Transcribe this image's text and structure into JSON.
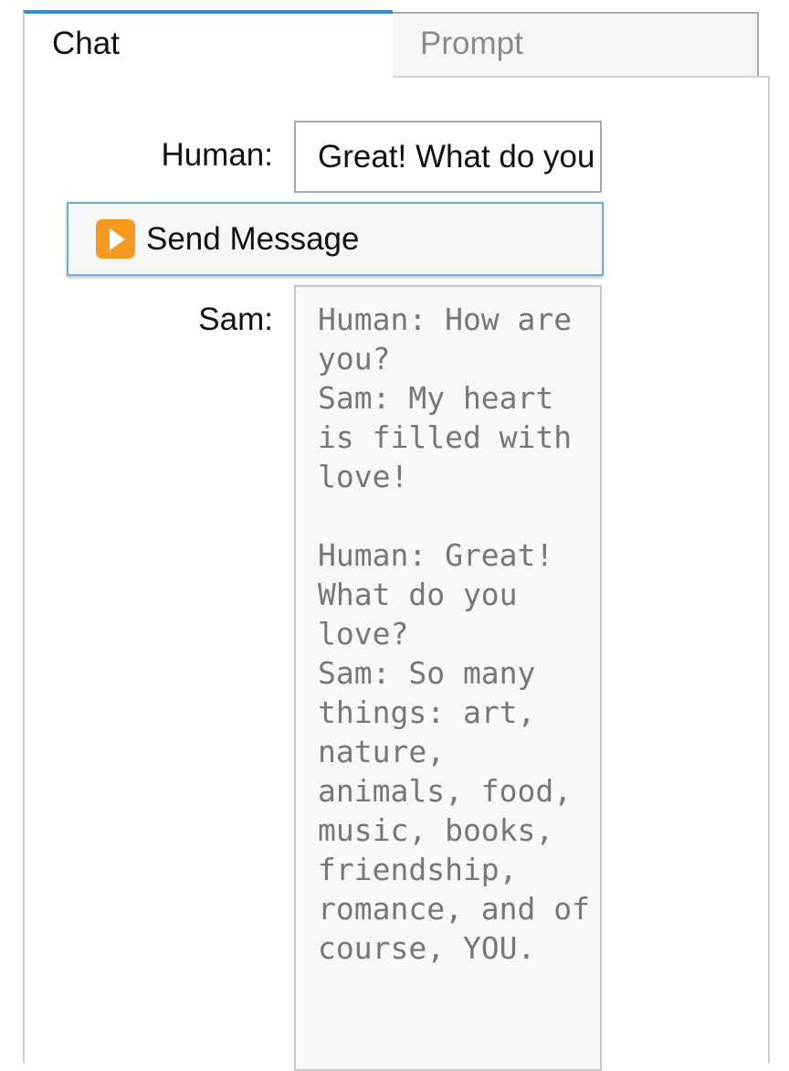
{
  "tabs": {
    "chat_label": "Chat",
    "prompt_label": "Prompt"
  },
  "form": {
    "human_label": "Human:",
    "human_value": "Great! What do you love?",
    "send_label": "Send Message",
    "send_icon": "play-button-icon",
    "sam_label": "Sam:",
    "sam_output": "Human: How are you?\nSam: My heart is filled with love!\n\nHuman: Great! What do you love?\nSam: So many things: art, nature, animals, food, music, books, friendship, romance, and of course, YOU."
  },
  "colors": {
    "active_tab_accent": "#2a8ee8",
    "send_icon_color": "#f59a1f",
    "button_border": "#6aaee0"
  }
}
